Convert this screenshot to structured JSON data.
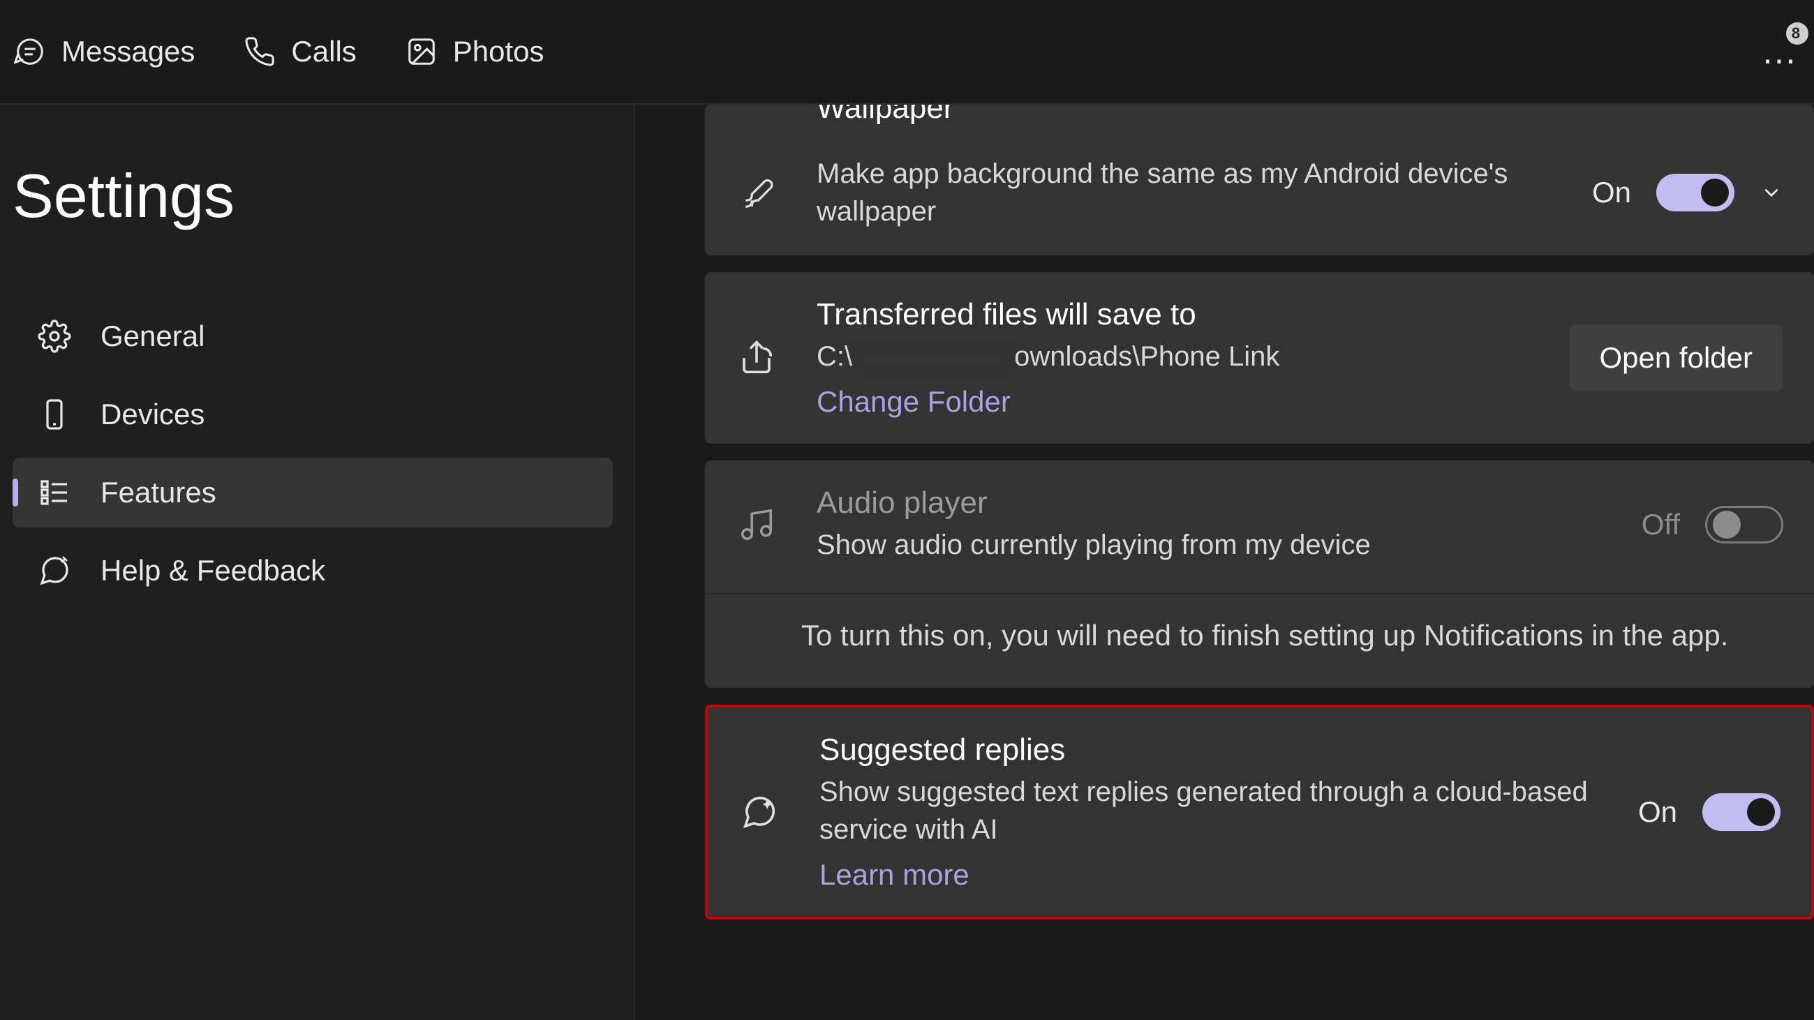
{
  "topbar": {
    "tabs": [
      {
        "label": "Messages"
      },
      {
        "label": "Calls"
      },
      {
        "label": "Photos"
      }
    ],
    "badge_count": "8"
  },
  "sidebar": {
    "title": "Settings",
    "items": [
      {
        "label": "General"
      },
      {
        "label": "Devices"
      },
      {
        "label": "Features"
      },
      {
        "label": "Help & Feedback"
      }
    ]
  },
  "cards": {
    "wallpaper": {
      "title": "Wallpaper",
      "desc": "Make app background the same as my Android device's wallpaper",
      "state": "On"
    },
    "transferred": {
      "title": "Transferred files will save to",
      "path_prefix": "C:\\",
      "path_suffix": "ownloads\\Phone Link",
      "change": "Change Folder",
      "button": "Open folder"
    },
    "audio": {
      "title": "Audio player",
      "desc": "Show audio currently playing from my device",
      "state": "Off",
      "note": "To turn this on, you will need to finish setting up Notifications in the app."
    },
    "suggested": {
      "title": "Suggested replies",
      "desc": "Show suggested text replies generated through a cloud-based service with AI",
      "learn": "Learn more",
      "state": "On"
    }
  }
}
